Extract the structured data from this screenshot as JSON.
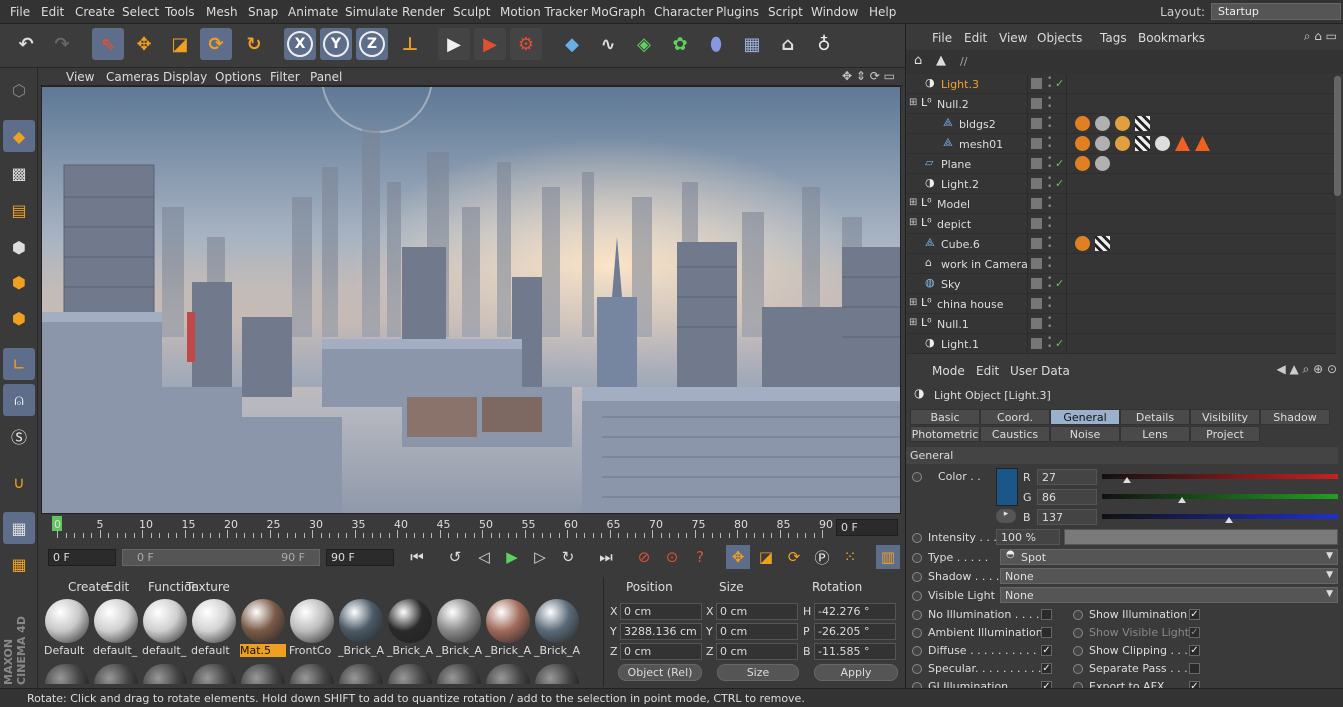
{
  "menubar": {
    "items": [
      "File",
      "Edit",
      "Create",
      "Select",
      "Tools",
      "Mesh",
      "Snap",
      "Animate",
      "Simulate",
      "Render",
      "Sculpt",
      "Motion Tracker",
      "MoGraph",
      "Character",
      "Plugins",
      "Script",
      "Window",
      "Help"
    ],
    "layout_label": "Layout:",
    "layout_value": "Startup"
  },
  "toolbar": {
    "axis_x": "X",
    "axis_y": "Y",
    "axis_z": "Z"
  },
  "viewport": {
    "menu": [
      "View",
      "Cameras",
      "Display",
      "Options",
      "Filter",
      "Panel"
    ]
  },
  "timeline": {
    "ticks": [
      "0",
      "5",
      "10",
      "15",
      "20",
      "25",
      "30",
      "35",
      "40",
      "45",
      "50",
      "55",
      "60",
      "65",
      "70",
      "75",
      "80",
      "85",
      "90"
    ],
    "current_frame": "0 F",
    "start_field": "0 F",
    "range_start": "0 F",
    "range_end": "90 F",
    "end_field": "90 F"
  },
  "materials": {
    "menu": [
      "Create",
      "Edit",
      "Function",
      "Texture"
    ],
    "items": [
      {
        "label": "Default",
        "color": "#c8c8c8"
      },
      {
        "label": "default_",
        "color": "#d0d0d0"
      },
      {
        "label": "default_",
        "color": "#cfcfcf"
      },
      {
        "label": "default",
        "color": "#d2d2d2"
      },
      {
        "label": "Mat.5",
        "color": "#7a5a48",
        "selected": true
      },
      {
        "label": "FrontCo",
        "color": "#bdbdbd"
      },
      {
        "label": "_Brick_A",
        "color": "#4a5a66"
      },
      {
        "label": "_Brick_A",
        "color": "#2a2a2a"
      },
      {
        "label": "_Brick_A",
        "color": "#8a8a8a"
      },
      {
        "label": "_Brick_A",
        "color": "#a06a5a"
      },
      {
        "label": "_Brick_A",
        "color": "#5a6a78"
      }
    ]
  },
  "coordinates": {
    "headers": [
      "Position",
      "Size",
      "Rotation"
    ],
    "rows": [
      {
        "axis": "X",
        "pos": "0 cm",
        "size_axis": "X",
        "size": "0 cm",
        "rot_axis": "H",
        "rot": "-42.276 °"
      },
      {
        "axis": "Y",
        "pos": "3288.136 cm",
        "size_axis": "Y",
        "size": "0 cm",
        "rot_axis": "P",
        "rot": "-26.205 °"
      },
      {
        "axis": "Z",
        "pos": "0 cm",
        "size_axis": "Z",
        "size": "0 cm",
        "rot_axis": "B",
        "rot": "-11.585 °"
      }
    ],
    "mode": "Object (Rel)",
    "size_mode": "Size",
    "apply": "Apply"
  },
  "object_manager": {
    "menu": [
      "File",
      "Edit",
      "View",
      "Objects",
      "Tags",
      "Bookmarks"
    ],
    "path": "//",
    "objects": [
      {
        "name": "Light.3",
        "selected": true,
        "check": "✓"
      },
      {
        "name": "Null.2",
        "check": ""
      },
      {
        "name": "bldgs2",
        "check": ""
      },
      {
        "name": "mesh01",
        "check": ""
      },
      {
        "name": "Plane",
        "check": "✓"
      },
      {
        "name": "Light.2",
        "check": "✓"
      },
      {
        "name": "Model",
        "check": ""
      },
      {
        "name": "depict",
        "check": ""
      },
      {
        "name": "Cube.6",
        "check": ""
      },
      {
        "name": "work in Camera",
        "check": ""
      },
      {
        "name": "Sky",
        "check": "✓"
      },
      {
        "name": "china house",
        "check": ""
      },
      {
        "name": "Null.1",
        "check": ""
      },
      {
        "name": "Light.1",
        "check": "✓"
      }
    ]
  },
  "attributes": {
    "menu": [
      "Mode",
      "Edit",
      "User Data"
    ],
    "title": "Light Object [Light.3]",
    "tabs_row1": [
      "Basic",
      "Coord.",
      "General",
      "Details",
      "Visibility",
      "Shadow"
    ],
    "tabs_row2": [
      "Photometric",
      "Caustics",
      "Noise",
      "Lens",
      "Project"
    ],
    "section": "General",
    "color_label": "Color . .",
    "color_hex": "#1b5689",
    "r_label": "R",
    "r": "27",
    "g_label": "G",
    "g": "86",
    "b_label": "B",
    "b": "137",
    "intensity_label": "Intensity . . .",
    "intensity": "100 %",
    "type_label": "Type . . . . .",
    "type": "Spot",
    "shadow_label": "Shadow . . . .",
    "shadow": "None",
    "visible_light_label": "Visible Light",
    "visible_light": "None",
    "flags_left": [
      {
        "label": "No Illumination . . . . .",
        "checked": false
      },
      {
        "label": "Ambient Illumination",
        "checked": false
      },
      {
        "label": "Diffuse . . . . . . . . . . . .",
        "checked": true
      },
      {
        "label": "Specular. . . . . . . . . . .",
        "checked": true
      },
      {
        "label": "GI Illumination . . . . .",
        "checked": true
      }
    ],
    "flags_right": [
      {
        "label": "Show Illumination",
        "checked": true
      },
      {
        "label": "Show Visible Light",
        "checked": true,
        "dim": true
      },
      {
        "label": "Show Clipping . . . .",
        "checked": true
      },
      {
        "label": "Separate Pass . . . .",
        "checked": false
      },
      {
        "label": "Export to AFX. . . . .",
        "checked": true
      }
    ]
  },
  "status": {
    "text": "Rotate: Click and drag to rotate elements. Hold down SHIFT to add to quantize rotation / add to the selection in point mode, CTRL to remove."
  },
  "branding": {
    "logo_text": "MAXON CINEMA 4D"
  }
}
